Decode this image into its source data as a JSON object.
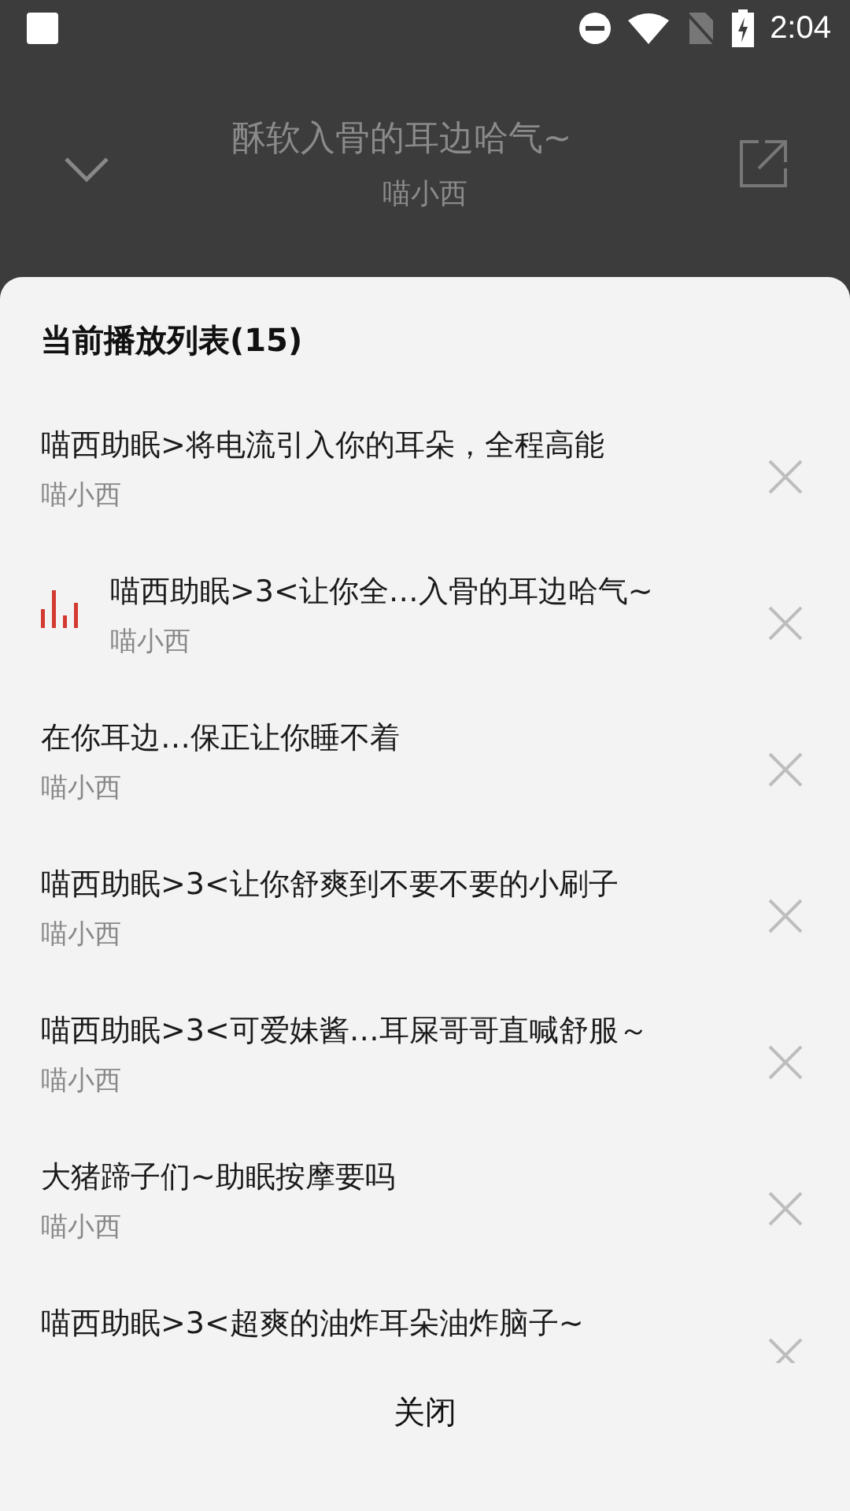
{
  "status_bar": {
    "time": "2:04"
  },
  "now_playing": {
    "title": "酥软入骨的耳边哈气~",
    "artist": "喵小西"
  },
  "playlist": {
    "title": "当前播放列表(15)",
    "items": [
      {
        "title": "喵西助眠>将电流引入你的耳朵，全程高能",
        "artist": "喵小西",
        "playing": false
      },
      {
        "title": "喵西助眠>3<让你全…入骨的耳边哈气~",
        "artist": "喵小西",
        "playing": true
      },
      {
        "title": "在你耳边…保正让你睡不着",
        "artist": "喵小西",
        "playing": false
      },
      {
        "title": "喵西助眠>3<让你舒爽到不要不要的小刷子",
        "artist": "喵小西",
        "playing": false
      },
      {
        "title": "喵西助眠>3<可爱妹酱…耳屎哥哥直喊舒服～",
        "artist": "喵小西",
        "playing": false
      },
      {
        "title": "大猪蹄子们~助眠按摩要吗",
        "artist": "喵小西",
        "playing": false
      },
      {
        "title": "喵西助眠>3<超爽的油炸耳朵油炸脑子~",
        "playing": false
      }
    ],
    "close_label": "关闭"
  }
}
